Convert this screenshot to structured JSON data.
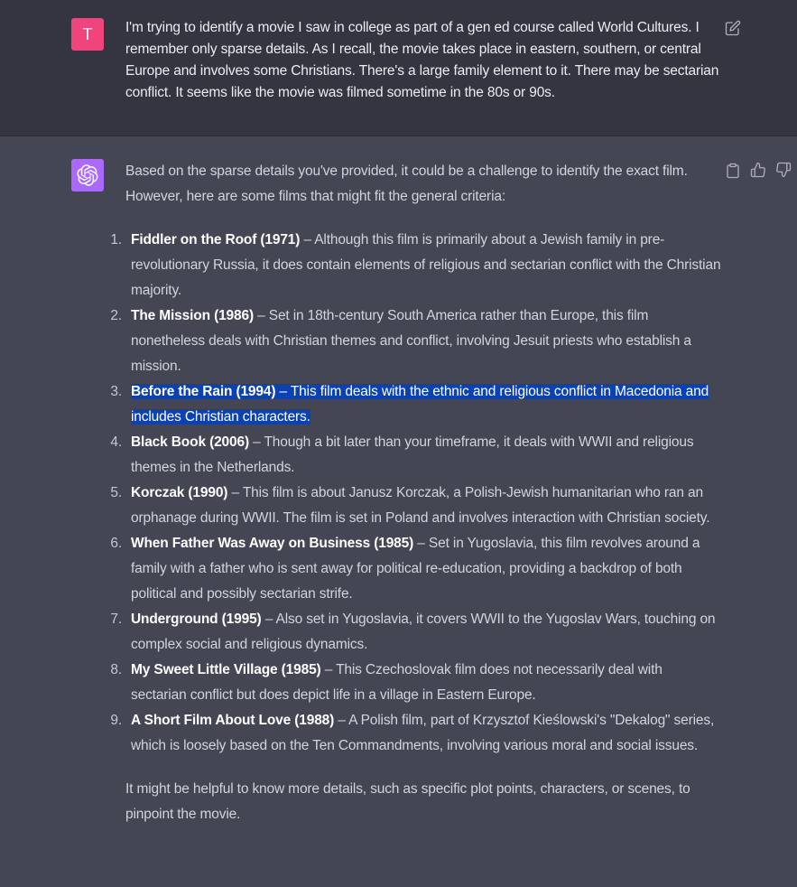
{
  "user_message": {
    "avatar_letter": "T",
    "text": "I'm trying to identify a movie I saw in college as part of a gen ed course called World Cultures. I remember only sparse details. As I recall, the movie takes place in eastern, southern, or central Europe and involves some Christians. There's a large family element to it. There may be sectarian conflict. It seems like the movie was filmed sometime in the 80s or 90s.",
    "edit_icon": "edit-icon"
  },
  "assistant_message": {
    "avatar_icon": "openai-logo-icon",
    "intro": "Based on the sparse details you've provided, it could be a challenge to identify the exact film. However, here are some films that might fit the general criteria:",
    "films": [
      {
        "num": "1.",
        "title": "Fiddler on the Roof (1971)",
        "desc": " – Although this film is primarily about a Jewish family in pre-revolutionary Russia, it does contain elements of religious and sectarian conflict with the Christian majority.",
        "highlighted": false
      },
      {
        "num": "2.",
        "title": "The Mission (1986)",
        "desc": " – Set in 18th-century South America rather than Europe, this film nonetheless deals with Christian themes and conflict, involving Jesuit priests who establish a mission.",
        "highlighted": false
      },
      {
        "num": "3.",
        "title": "Before the Rain (1994)",
        "desc": " – This film deals with the ethnic and religious conflict in Macedonia and includes Christian characters.",
        "highlighted": true
      },
      {
        "num": "4.",
        "title": "Black Book (2006)",
        "desc": " – Though a bit later than your timeframe, it deals with WWII and religious themes in the Netherlands.",
        "highlighted": false
      },
      {
        "num": "5.",
        "title": "Korczak (1990)",
        "desc": " – This film is about Janusz Korczak, a Polish-Jewish humanitarian who ran an orphanage during WWII. The film is set in Poland and involves interaction with Christian society.",
        "highlighted": false
      },
      {
        "num": "6.",
        "title": "When Father Was Away on Business (1985)",
        "desc": " – Set in Yugoslavia, this film revolves around a family with a father who is sent away for political re-education, providing a backdrop of both political and possibly sectarian strife.",
        "highlighted": false
      },
      {
        "num": "7.",
        "title": "Underground (1995)",
        "desc": " – Also set in Yugoslavia, it covers WWII to the Yugoslav Wars, touching on complex social and religious dynamics.",
        "highlighted": false
      },
      {
        "num": "8.",
        "title": "My Sweet Little Village (1985)",
        "desc": " – This Czechoslovak film does not necessarily deal with sectarian conflict but does depict life in a village in Eastern Europe.",
        "highlighted": false
      },
      {
        "num": "9.",
        "title": "A Short Film About Love (1988)",
        "desc": " – A Polish film, part of Krzysztof Kieślowski's \"Dekalog\" series, which is loosely based on the Ten Commandments, involving various moral and social issues.",
        "highlighted": false
      }
    ],
    "outro": "It might be helpful to know more details, such as specific plot points, characters, or scenes, to pinpoint the movie.",
    "actions": [
      "copy-icon",
      "thumbs-up-icon",
      "thumbs-down-icon"
    ]
  },
  "colors": {
    "user_bg": "#343541",
    "assistant_bg": "#444654",
    "user_avatar": "#f0447d",
    "bot_avatar": "#ab68ff",
    "highlight": "#0a41b3"
  }
}
